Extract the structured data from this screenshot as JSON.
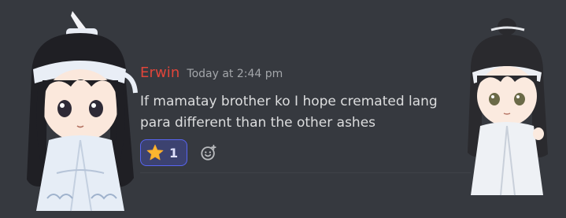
{
  "message": {
    "username": "Erwin",
    "timestamp": "Today at 2:44 pm",
    "body": "If mamatay brother ko I hope cremated lang para different than the other ashes"
  },
  "reactions": [
    {
      "emoji_icon": "star-emoji",
      "count": "1"
    }
  ],
  "add_reaction_icon": "add-reaction-smiley-icon",
  "colors": {
    "background": "#36393f",
    "username": "#e0453a",
    "timestamp": "#a3a6aa",
    "body_text": "#dcddde",
    "reaction_bg": "#3c4270",
    "reaction_border": "#5865f2"
  }
}
